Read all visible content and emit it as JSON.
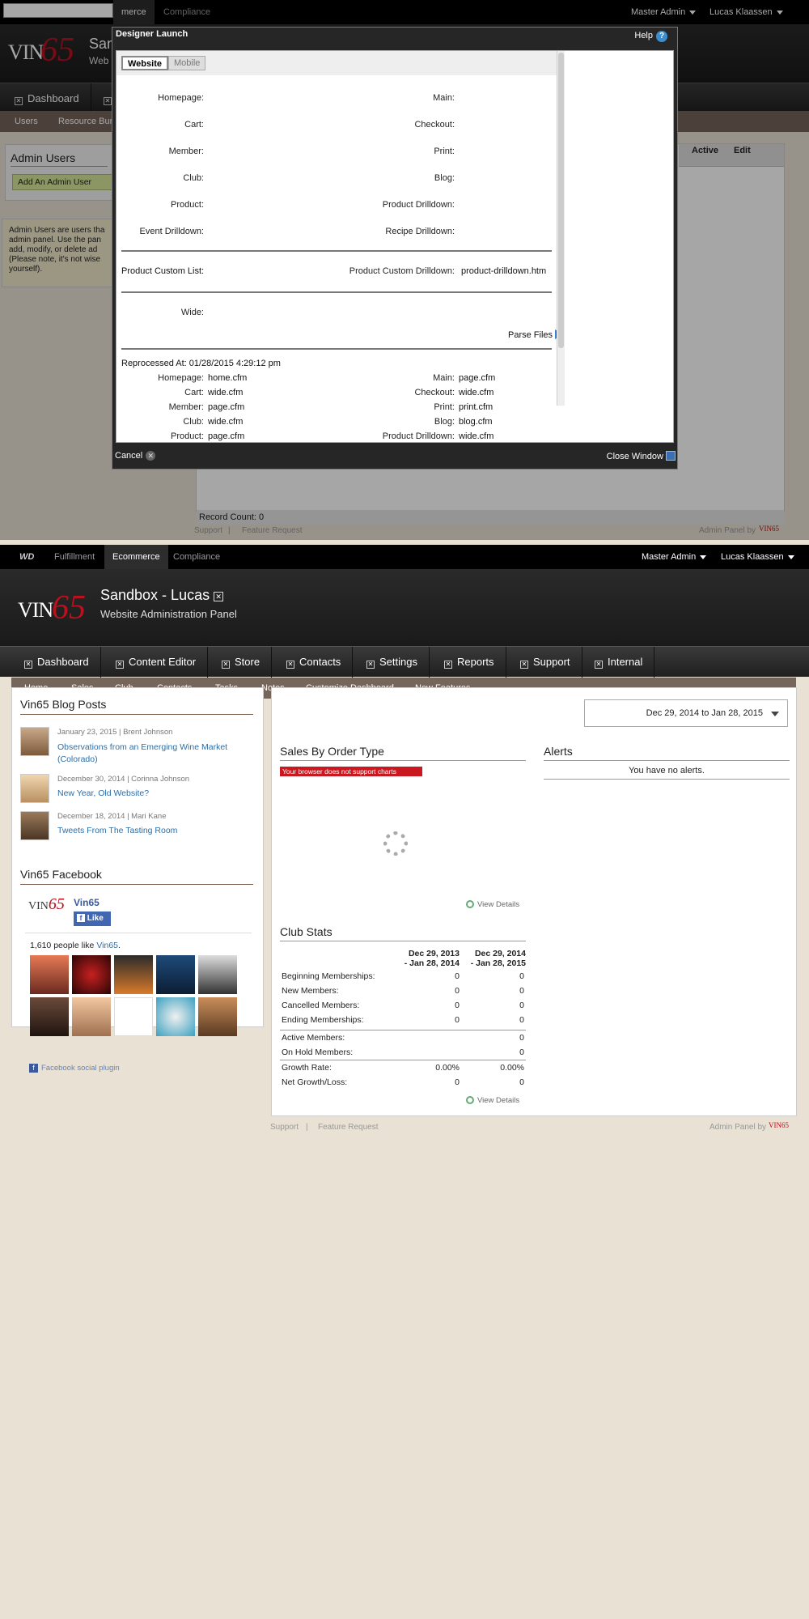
{
  "top": {
    "topbar": {
      "tab_partial": "merce",
      "tab_compliance": "Compliance",
      "master_admin": "Master Admin",
      "user": "Lucas Klaassen"
    },
    "header": {
      "site_partial": "San",
      "sub_partial": "Web"
    },
    "nav": {
      "dashboard": "Dashboard"
    },
    "subnav": {
      "users": "Users",
      "resource": "Resource Bun"
    },
    "admin_users": {
      "title": "Admin Users",
      "add_button": "Add An Admin User",
      "help_text": "Admin Users are users tha admin panel. Use the pan add, modify, or delete ad (Please note, it's not wise yourself)."
    },
    "table": {
      "col_active": "Active",
      "col_edit": "Edit",
      "record_count": "Record Count: 0"
    },
    "footer": {
      "support": "Support",
      "feature_request": "Feature Request",
      "admin_panel_by": "Admin Panel by"
    }
  },
  "modal": {
    "title": "Designer Launch",
    "help": "Help",
    "tabs": [
      "Website",
      "Mobile"
    ],
    "left_labels": [
      "Homepage:",
      "Cart:",
      "Member:",
      "Club:",
      "Product:",
      "Event Drilldown:"
    ],
    "right_labels": [
      "Main:",
      "Checkout:",
      "Print:",
      "Blog:",
      "Product Drilldown:",
      "Recipe Drilldown:"
    ],
    "custom_list_label": "Product Custom List:",
    "custom_drilldown_label": "Product Custom Drilldown:",
    "custom_drilldown_value": "product-drilldown.htm",
    "wide_label": "Wide:",
    "parse_files": "Parse Files",
    "reprocessed": "Reprocessed At: 01/28/2015 4:29:12 pm",
    "processed_left": [
      [
        "Homepage:",
        "home.cfm"
      ],
      [
        "Cart:",
        "wide.cfm"
      ],
      [
        "Member:",
        "page.cfm"
      ],
      [
        "Club:",
        "wide.cfm"
      ],
      [
        "Product:",
        "page.cfm"
      ]
    ],
    "processed_right": [
      [
        "Main:",
        "page.cfm"
      ],
      [
        "Checkout:",
        "wide.cfm"
      ],
      [
        "Print:",
        "print.cfm"
      ],
      [
        "Blog:",
        "blog.cfm"
      ],
      [
        "Product Drilldown:",
        "wide.cfm"
      ]
    ],
    "cancel": "Cancel",
    "close_window": "Close Window"
  },
  "bottom": {
    "topbar": {
      "wd": "WD",
      "fulfillment": "Fulfillment",
      "ecommerce": "Ecommerce",
      "compliance": "Compliance",
      "master_admin": "Master Admin",
      "user": "Lucas Klaassen"
    },
    "header": {
      "site_name": "Sandbox - Lucas",
      "subtitle": "Website Administration Panel"
    },
    "nav": [
      "Dashboard",
      "Content Editor",
      "Store",
      "Contacts",
      "Settings",
      "Reports",
      "Support",
      "Internal"
    ],
    "subnav": [
      "Home",
      "Sales",
      "Club",
      "Contacts",
      "Tasks",
      "Notes",
      "Customize Dashboard",
      "New Features"
    ],
    "blog": {
      "title": "Vin65 Blog Posts",
      "posts": [
        {
          "meta": "January 23, 2015  |  Brent Johnson",
          "title": "Observations from an Emerging Wine Market (Colorado)"
        },
        {
          "meta": "December 30, 2014  |  Corinna Johnson",
          "title": "New Year, Old Website?"
        },
        {
          "meta": "December 18, 2014  |  Mari Kane",
          "title": "Tweets From The Tasting Room"
        }
      ]
    },
    "facebook": {
      "title": "Vin65 Facebook",
      "page_name": "Vin65",
      "like": "Like",
      "people_text": "1,610 people like ",
      "people_link": "Vin65",
      "plugin": "Facebook social plugin"
    },
    "date_range": "Dec 29, 2014 to Jan 28, 2015",
    "sales": {
      "title": "Sales By Order Type",
      "error": "Your browser does not support charts",
      "view_details": "View Details"
    },
    "alerts": {
      "title": "Alerts",
      "empty": "You have no alerts."
    },
    "club": {
      "title": "Club Stats",
      "col1": [
        "Dec 29, 2013",
        "- Jan 28, 2014"
      ],
      "col2": [
        "Dec 29, 2014",
        "- Jan 28, 2015"
      ],
      "rows": [
        [
          "Beginning Memberships:",
          "0",
          "0"
        ],
        [
          "New Members:",
          "0",
          "0"
        ],
        [
          "Cancelled Members:",
          "0",
          "0"
        ],
        [
          "Ending Memberships:",
          "0",
          "0"
        ]
      ],
      "rows2": [
        [
          "Active Members:",
          "",
          "0"
        ],
        [
          "On Hold Members:",
          "",
          "0"
        ]
      ],
      "rows3": [
        [
          "Growth Rate:",
          "0.00%",
          "0.00%"
        ],
        [
          "Net Growth/Loss:",
          "0",
          "0"
        ]
      ],
      "view_details": "View Details"
    },
    "footer": {
      "support": "Support",
      "feature_request": "Feature Request",
      "admin_panel_by": "Admin Panel by"
    }
  },
  "logo": {
    "vin": "VIN",
    "num": "65"
  },
  "colors": {
    "brand_red": "#b8121e",
    "link": "#2b6ea8",
    "subnav": "#75655a"
  }
}
